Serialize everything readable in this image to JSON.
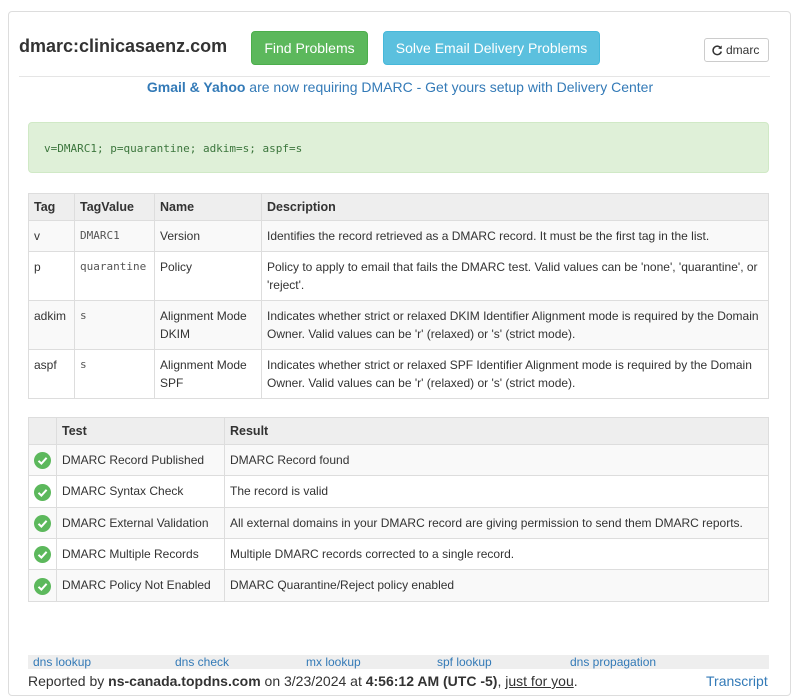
{
  "header": {
    "title": "dmarc:clinicasaenz.com",
    "find_problems": "Find Problems",
    "solve_problems": "Solve Email Delivery Problems",
    "dmarc_button": "dmarc"
  },
  "notice": {
    "brands": "Gmail & Yahoo",
    "text": " are now requiring DMARC - Get yours setup with Delivery Center"
  },
  "record": "v=DMARC1; p=quarantine; adkim=s; aspf=s",
  "tag_table": {
    "headers": [
      "Tag",
      "TagValue",
      "Name",
      "Description"
    ],
    "rows": [
      {
        "tag": "v",
        "value": "DMARC1",
        "name": "Version",
        "description": "Identifies the record retrieved as a DMARC record. It must be the first tag in the list."
      },
      {
        "tag": "p",
        "value": "quarantine",
        "name": "Policy",
        "description": "Policy to apply to email that fails the DMARC test. Valid values can be 'none', 'quarantine', or 'reject'."
      },
      {
        "tag": "adkim",
        "value": "s",
        "name": "Alignment Mode DKIM",
        "description": "Indicates whether strict or relaxed DKIM Identifier Alignment mode is required by the Domain Owner. Valid values can be 'r' (relaxed) or 's' (strict mode)."
      },
      {
        "tag": "aspf",
        "value": "s",
        "name": "Alignment Mode SPF",
        "description": "Indicates whether strict or relaxed SPF Identifier Alignment mode is required by the Domain Owner. Valid values can be 'r' (relaxed) or 's' (strict mode)."
      }
    ]
  },
  "test_table": {
    "headers": [
      "",
      "Test",
      "Result"
    ],
    "rows": [
      {
        "test": "DMARC Record Published",
        "result": "DMARC Record found"
      },
      {
        "test": "DMARC Syntax Check",
        "result": "The record is valid"
      },
      {
        "test": "DMARC External Validation",
        "result": "All external domains in your DMARC record are giving permission to send them DMARC reports."
      },
      {
        "test": "DMARC Multiple Records",
        "result": "Multiple DMARC records corrected to a single record."
      },
      {
        "test": "DMARC Policy Not Enabled",
        "result": "DMARC Quarantine/Reject policy enabled"
      }
    ]
  },
  "footer": {
    "links": [
      "dns lookup",
      "dns check",
      "mx lookup",
      "spf lookup",
      "dns propagation"
    ],
    "reported_by": "Reported by ",
    "server": "ns-canada.topdns.com",
    "on": " on 3/23/2024 at ",
    "time": "4:56:12 AM (UTC -5)",
    "sep": ", ",
    "just_for_you": "just for you",
    "period": ".",
    "transcript": "Transcript"
  },
  "colors": {
    "success": "#5cb85c",
    "info": "#5bc0de",
    "link": "#337ab7",
    "record_bg": "#dff0d8"
  }
}
